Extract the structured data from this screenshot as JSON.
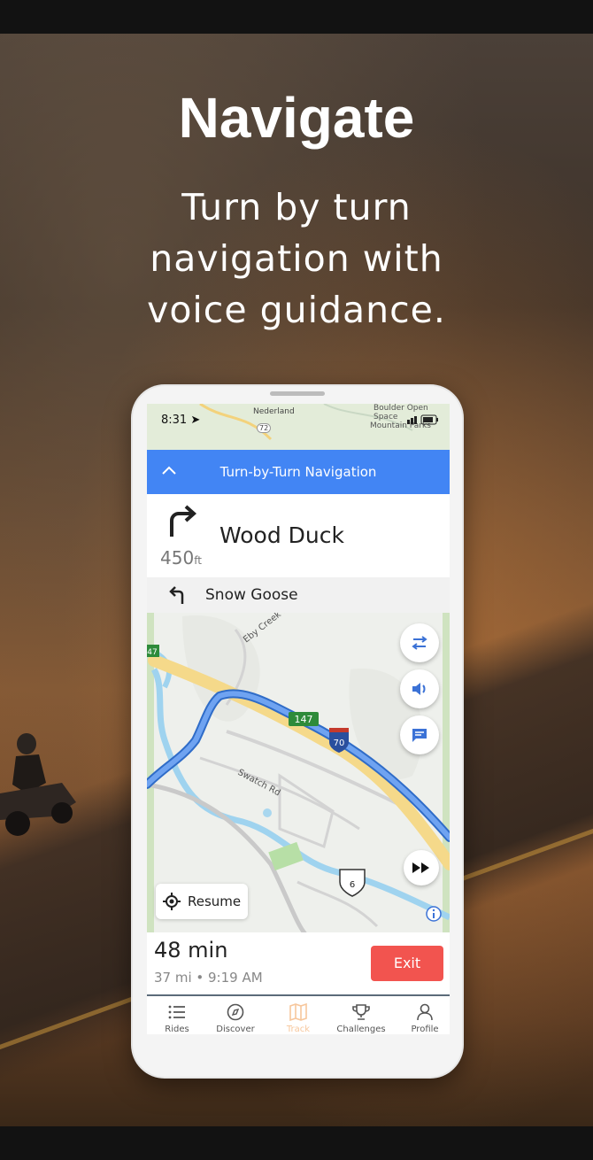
{
  "hero": {
    "title": "Navigate",
    "subtitle_lines": [
      "Turn by turn",
      "navigation with",
      "voice guidance."
    ]
  },
  "phone": {
    "status": {
      "time": "8:31",
      "map_labels": [
        "Nederland",
        "Boulder Open Space",
        "Mountain Parks",
        "72"
      ]
    },
    "nav_header": {
      "title": "Turn-by-Turn Navigation"
    },
    "current_turn": {
      "street": "Wood Duck",
      "distance": "450",
      "unit": "ft",
      "icon": "turn-right-icon"
    },
    "next_turn": {
      "street": "Snow Goose",
      "icon": "turn-left-icon"
    },
    "map": {
      "labels": {
        "eby": "Eby Creek Rd",
        "swatch": "Swatch Rd",
        "hwy147": "147",
        "i70": "70",
        "us6": "6",
        "side47": "47"
      }
    },
    "fabs": [
      "route-options-icon",
      "volume-icon",
      "chat-icon",
      "fast-forward-icon"
    ],
    "resume_label": "Resume",
    "eta": {
      "duration": "48 min",
      "detail": "37 mi • 9:19 AM"
    },
    "exit_label": "Exit",
    "tabs": [
      {
        "label": "Rides",
        "icon": "list-icon"
      },
      {
        "label": "Discover",
        "icon": "compass-icon"
      },
      {
        "label": "Track",
        "icon": "map-icon",
        "active": true
      },
      {
        "label": "Challenges",
        "icon": "trophy-icon"
      },
      {
        "label": "Profile",
        "icon": "user-icon"
      }
    ],
    "colors": {
      "header": "#4285f4",
      "exit": "#f2544f",
      "route": "#4a86e8",
      "active_tab": "#f7c79c"
    }
  }
}
